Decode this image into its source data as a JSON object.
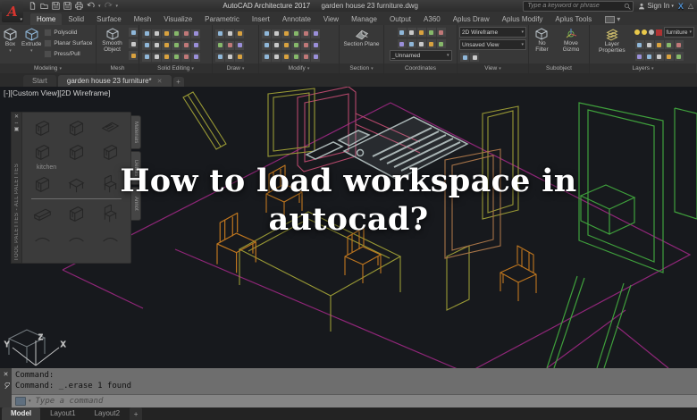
{
  "colors": {
    "canvas_bg": "#17191d",
    "magenta": "#8f2678",
    "pink_frame": "#b5486b",
    "green": "#3fa03c",
    "olive": "#9a9a35",
    "orange": "#c0771f",
    "tan": "#a87448",
    "gray_object": "#aab6b6",
    "logo_red": "#d6352f",
    "exchange_blue": "#4f8fd0",
    "layer_red": "#b03333"
  },
  "title_bar": {
    "app_title": "AutoCAD Architecture 2017",
    "document_title": "garden house 23 furniture.dwg",
    "search_placeholder": "Type a keyword or phrase",
    "sign_in": "Sign In"
  },
  "ribbon_tabs": [
    {
      "label": "Home"
    },
    {
      "label": "Solid"
    },
    {
      "label": "Surface"
    },
    {
      "label": "Mesh"
    },
    {
      "label": "Visualize"
    },
    {
      "label": "Parametric"
    },
    {
      "label": "Insert"
    },
    {
      "label": "Annotate"
    },
    {
      "label": "View"
    },
    {
      "label": "Manage"
    },
    {
      "label": "Output"
    },
    {
      "label": "A360"
    },
    {
      "label": "Aplus Draw"
    },
    {
      "label": "Aplus Modify"
    },
    {
      "label": "Aplus Tools"
    }
  ],
  "panels": {
    "modeling": {
      "label": "Modeling",
      "box": "Box",
      "extrude": "Extrude",
      "polysolid": "Polysolid",
      "planar": "Planar Surface",
      "presspull": "Press/Pull"
    },
    "mesh": {
      "label": "Mesh",
      "smooth": "Smooth Object"
    },
    "solid_editing": {
      "label": "Solid Editing"
    },
    "draw": {
      "label": "Draw"
    },
    "modify": {
      "label": "Modify"
    },
    "section": {
      "label": "Section",
      "plane": "Section Plane"
    },
    "coordinates": {
      "label": "Coordinates",
      "ucs_name": "_Unnamed"
    },
    "view": {
      "label": "View",
      "visual_style": "2D Wireframe",
      "saved_view": "Unsaved View"
    },
    "subobject": {
      "label": "Subobject",
      "no_filter": "No Filter",
      "gizmo": "Move Gizmo"
    },
    "layers": {
      "label": "Layers",
      "props": "Layer Properties",
      "current": "furniture"
    }
  },
  "file_tabs": {
    "start": "Start",
    "doc": "garden house 23 furniture*",
    "add": "+"
  },
  "viewport": {
    "label": "[-][Custom View][2D Wireframe]"
  },
  "overlay": {
    "line1": "How to load workspace in",
    "line2": "autocad?"
  },
  "palette": {
    "title": "TOOL PALETTES - ALL PALETTES",
    "group": "kitchen",
    "tabs": [
      "Materials",
      "Details",
      "Annot"
    ]
  },
  "ucs": {
    "x": "X",
    "y": "Y",
    "z": "Z"
  },
  "command": {
    "line1": "Command:",
    "line2": "Command: _.erase 1 found",
    "placeholder": "Type a command"
  },
  "layout_tabs": {
    "model": "Model",
    "layout1": "Layout1",
    "layout2": "Layout2",
    "add": "+"
  }
}
